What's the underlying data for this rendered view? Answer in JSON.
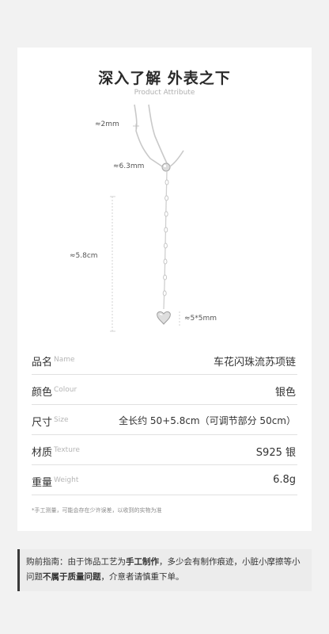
{
  "header": {
    "title": "深入了解 外表之下",
    "subtitle": "Product Attribute"
  },
  "dimensions": {
    "chain_width": "≈2mm",
    "bead_size": "≈6.3mm",
    "tassel_length": "≈5.8cm",
    "pendant_size": "≈5*5mm"
  },
  "attributes": [
    {
      "name": "品名",
      "name_en": "Name",
      "value": "车花闪珠流苏项链"
    },
    {
      "name": "颜色",
      "name_en": "Colour",
      "value": "银色"
    },
    {
      "name": "尺寸",
      "name_en": "Size",
      "value": "全长约 50+5.8cm（可调节部分 50cm）"
    },
    {
      "name": "材质",
      "name_en": "Texture",
      "value": "S925 银"
    },
    {
      "name": "重量",
      "name_en": "Weight",
      "value": "6.8g"
    }
  ],
  "note": "*手工测量，可能会存在少许误差，以收到的实物为准",
  "notice": {
    "prefix": "购前指南：由于饰品工艺为",
    "bold1": "手工制作",
    "middle": "，多少会有制作痕迹，小脏小摩擦等小问题",
    "bold2": "不属于质量问题",
    "suffix": "，介意者请慎重下单。"
  }
}
